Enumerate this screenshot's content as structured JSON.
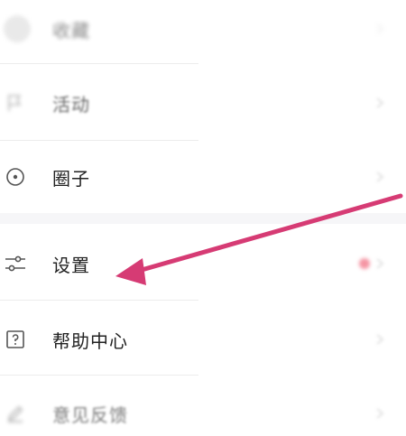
{
  "menu": {
    "items": [
      {
        "label": "收藏",
        "icon": "avatar-icon"
      },
      {
        "label": "活动",
        "icon": "flag-icon"
      },
      {
        "label": "圈子",
        "icon": "circle-target-icon"
      },
      {
        "label": "设置",
        "icon": "sliders-icon"
      },
      {
        "label": "帮助中心",
        "icon": "question-box-icon"
      },
      {
        "label": "意见反馈",
        "icon": "pencil-icon"
      }
    ]
  },
  "annotation": {
    "arrow_color": "#d63b74",
    "points_to": "设置"
  },
  "colors": {
    "text": "#222222",
    "icon": "#555555",
    "divider": "#ececec",
    "section_bg": "#f6f6f8",
    "badge": "#f27a8c"
  }
}
